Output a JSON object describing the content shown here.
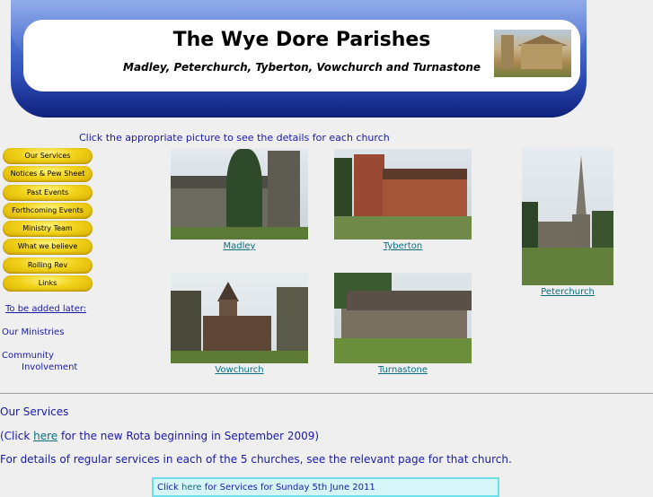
{
  "header": {
    "title": "The Wye Dore Parishes",
    "subtitle": "Madley, Peterchurch, Tyberton, Vowchurch and Turnastone"
  },
  "intro": "Click the appropriate picture to see the details for each church",
  "menu": [
    "Our Services",
    "Notices & Pew Sheet",
    "Past Events",
    "Forthcoming Events",
    "Ministry Team",
    "What we believe",
    "Rolling Rev",
    "Links"
  ],
  "sidebar": {
    "later": "To be added later:",
    "ministries": "Our Ministries",
    "community_1": "Community",
    "community_2": "Involvement"
  },
  "churches": {
    "madley": "Madley",
    "tyberton": "Tyberton",
    "peterchurch": "Peterchurch",
    "vowchurch": "Vowchurch",
    "turnastone": "Turnastone"
  },
  "services": {
    "title": "Our Services",
    "line1_pre": "(Click ",
    "line1_link": "here",
    "line1_post": " for the new Rota beginning in September 2009)",
    "line2": "For details of regular services in each of the 5 churches, see the relevant page for that church.",
    "notice_pre": "Click ",
    "notice_link": "here",
    "notice_post": " for Services for Sunday 5th June 2011"
  },
  "colors": {
    "banner": "#2f4fb8",
    "menu_button": "#f1d21a",
    "link": "#0a6e7e",
    "text": "#1a1aa8"
  }
}
